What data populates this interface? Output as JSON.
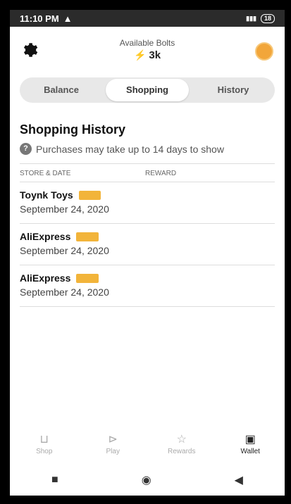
{
  "statusbar": {
    "time": "11:10 PM",
    "alert_icon": "warning-icon",
    "battery": "18"
  },
  "header": {
    "bolts_label": "Available Bolts",
    "bolts_value": "3k"
  },
  "tabs": [
    {
      "label": "Balance"
    },
    {
      "label": "Shopping"
    },
    {
      "label": "History"
    }
  ],
  "history": {
    "title": "Shopping History",
    "note": "Purchases may take up to 14 days to show",
    "col_store": "STORE & DATE",
    "col_reward": "REWARD",
    "rows": [
      {
        "store": "Toynk Toys",
        "date": "September 24, 2020",
        "badge": ""
      },
      {
        "store": "AliExpress",
        "date": "September 24, 2020",
        "badge": ""
      },
      {
        "store": "AliExpress",
        "date": "September 24, 2020",
        "badge": ""
      }
    ]
  },
  "nav": [
    {
      "label": "Shop",
      "icon": "basket-icon"
    },
    {
      "label": "Play",
      "icon": "play-icon"
    },
    {
      "label": "Rewards",
      "icon": "star-icon"
    },
    {
      "label": "Wallet",
      "icon": "wallet-icon"
    }
  ],
  "colors": {
    "accent": "#f2b43a",
    "active_tab_bg": "#ffffff",
    "tabs_bg": "#e8e8e8"
  }
}
